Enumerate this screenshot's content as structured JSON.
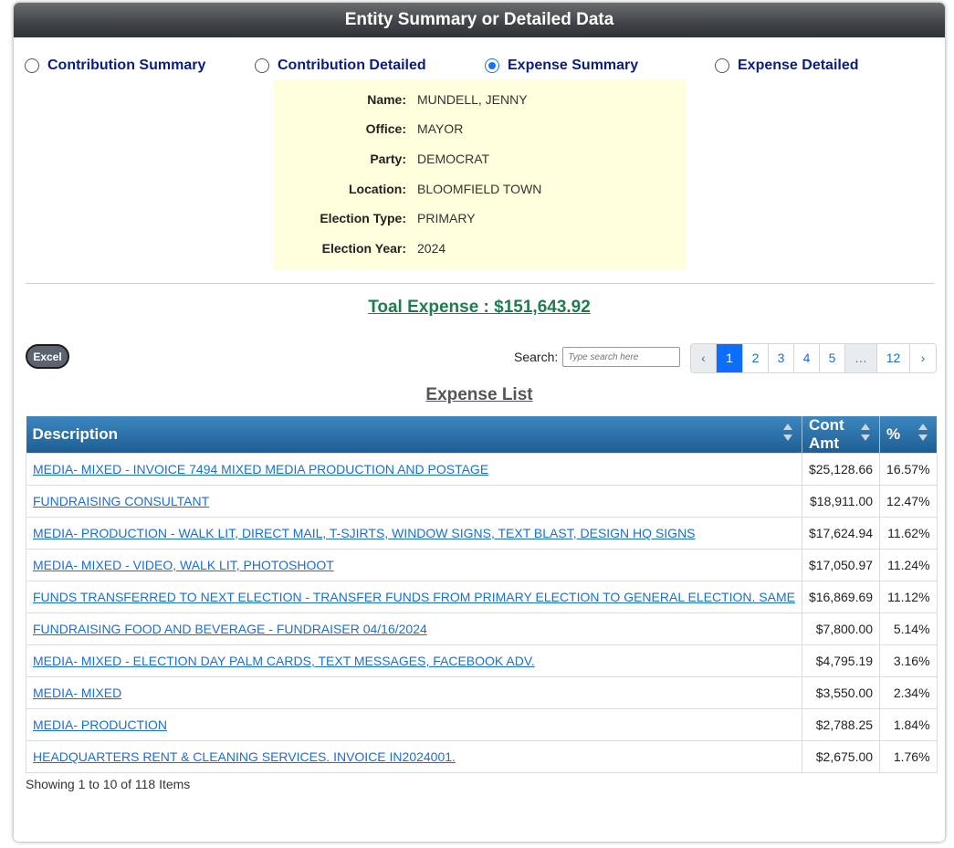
{
  "header": {
    "title": "Entity Summary or Detailed Data"
  },
  "view_options": [
    {
      "label": "Contribution Summary",
      "checked": false
    },
    {
      "label": "Contribution Detailed",
      "checked": false
    },
    {
      "label": "Expense Summary",
      "checked": true
    },
    {
      "label": "Expense Detailed",
      "checked": false
    }
  ],
  "entity": [
    {
      "label": "Name:",
      "value": "MUNDELL, JENNY"
    },
    {
      "label": "Office:",
      "value": "MAYOR"
    },
    {
      "label": "Party:",
      "value": "DEMOCRAT"
    },
    {
      "label": "Location:",
      "value": "BLOOMFIELD TOWN"
    },
    {
      "label": "Election Type:",
      "value": "PRIMARY"
    },
    {
      "label": "Election Year:",
      "value": "2024"
    }
  ],
  "total": {
    "text": "Toal Expense : $151,643.92"
  },
  "toolbar": {
    "excel_label": "Excel",
    "search_label": "Search:",
    "search_placeholder": "Type search here"
  },
  "pagination": {
    "prev": "‹",
    "pages": [
      "1",
      "2",
      "3",
      "4",
      "5"
    ],
    "active": "1",
    "ellipsis": "…",
    "last": "12",
    "next": "›"
  },
  "list_title": "Expense List",
  "table": {
    "columns": [
      "Description",
      "Cont Amt",
      "%"
    ],
    "rows": [
      {
        "desc": "MEDIA- MIXED - INVOICE 7494 MIXED MEDIA PRODUCTION AND POSTAGE",
        "amt": "$25,128.66",
        "pct": "16.57%"
      },
      {
        "desc": "FUNDRAISING CONSULTANT",
        "amt": "$18,911.00",
        "pct": "12.47%"
      },
      {
        "desc": "MEDIA- PRODUCTION - WALK LIT, DIRECT MAIL, T-SJIRTS, WINDOW SIGNS, TEXT BLAST, DESIGN HQ SIGNS",
        "amt": "$17,624.94",
        "pct": "11.62%"
      },
      {
        "desc": "MEDIA- MIXED - VIDEO, WALK LIT, PHOTOSHOOT",
        "amt": "$17,050.97",
        "pct": "11.24%"
      },
      {
        "desc": "FUNDS TRANSFERRED TO NEXT ELECTION - TRANSFER FUNDS FROM PRIMARY ELECTION TO GENERAL ELECTION. SAME",
        "amt": "$16,869.69",
        "pct": "11.12%"
      },
      {
        "desc": "FUNDRAISING FOOD AND BEVERAGE - FUNDRAISER 04/16/2024",
        "amt": "$7,800.00",
        "pct": "5.14%"
      },
      {
        "desc": "MEDIA- MIXED - ELECTION DAY PALM CARDS, TEXT MESSAGES, FACEBOOK ADV.",
        "amt": "$4,795.19",
        "pct": "3.16%"
      },
      {
        "desc": "MEDIA- MIXED",
        "amt": "$3,550.00",
        "pct": "2.34%"
      },
      {
        "desc": "MEDIA- PRODUCTION",
        "amt": "$2,788.25",
        "pct": "1.84%"
      },
      {
        "desc": "HEADQUARTERS RENT & CLEANING SERVICES. INVOICE IN2024001.",
        "amt": "$2,675.00",
        "pct": "1.76%"
      }
    ]
  },
  "footer": {
    "showing": "Showing 1 to 10 of 118 Items"
  }
}
